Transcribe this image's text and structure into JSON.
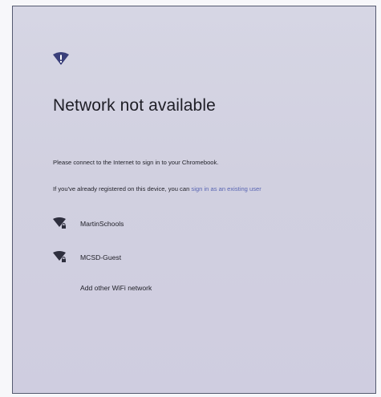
{
  "colors": {
    "accent": "#3a3f7a",
    "link": "#5a66b3",
    "panel": "#d3d2e2",
    "border": "#555a70"
  },
  "header": {
    "icon": "wifi-alert-icon",
    "title": "Network not available"
  },
  "message": {
    "line1": "Please connect to the Internet to sign in to your Chromebook.",
    "line2_prefix": "If you've already registered on this device, you can ",
    "line2_link": "sign in as an existing user"
  },
  "networks": [
    {
      "name": "MartinSchools",
      "icon": "wifi-locked-icon"
    },
    {
      "name": "MCSD-Guest",
      "icon": "wifi-locked-icon"
    }
  ],
  "add_network_label": "Add other WiFi network"
}
